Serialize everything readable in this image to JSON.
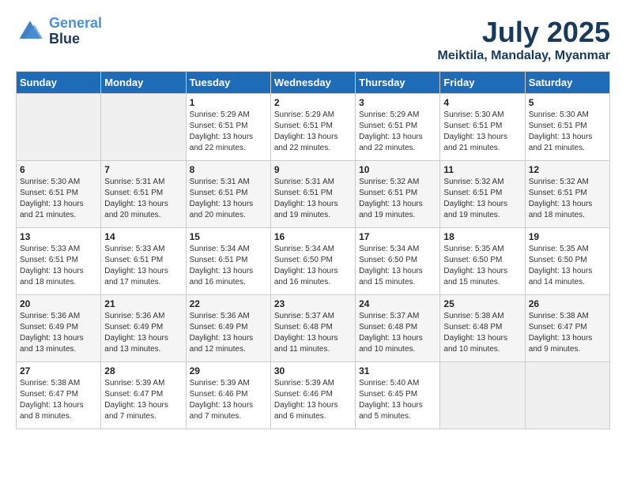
{
  "header": {
    "logo_line1": "General",
    "logo_line2": "Blue",
    "month": "July 2025",
    "location": "Meiktila, Mandalay, Myanmar"
  },
  "weekdays": [
    "Sunday",
    "Monday",
    "Tuesday",
    "Wednesday",
    "Thursday",
    "Friday",
    "Saturday"
  ],
  "weeks": [
    [
      {
        "day": "",
        "empty": true
      },
      {
        "day": "",
        "empty": true
      },
      {
        "day": "1",
        "sunrise": "5:29 AM",
        "sunset": "6:51 PM",
        "daylight": "13 hours and 22 minutes."
      },
      {
        "day": "2",
        "sunrise": "5:29 AM",
        "sunset": "6:51 PM",
        "daylight": "13 hours and 22 minutes."
      },
      {
        "day": "3",
        "sunrise": "5:29 AM",
        "sunset": "6:51 PM",
        "daylight": "13 hours and 22 minutes."
      },
      {
        "day": "4",
        "sunrise": "5:30 AM",
        "sunset": "6:51 PM",
        "daylight": "13 hours and 21 minutes."
      },
      {
        "day": "5",
        "sunrise": "5:30 AM",
        "sunset": "6:51 PM",
        "daylight": "13 hours and 21 minutes."
      }
    ],
    [
      {
        "day": "6",
        "sunrise": "5:30 AM",
        "sunset": "6:51 PM",
        "daylight": "13 hours and 21 minutes."
      },
      {
        "day": "7",
        "sunrise": "5:31 AM",
        "sunset": "6:51 PM",
        "daylight": "13 hours and 20 minutes."
      },
      {
        "day": "8",
        "sunrise": "5:31 AM",
        "sunset": "6:51 PM",
        "daylight": "13 hours and 20 minutes."
      },
      {
        "day": "9",
        "sunrise": "5:31 AM",
        "sunset": "6:51 PM",
        "daylight": "13 hours and 19 minutes."
      },
      {
        "day": "10",
        "sunrise": "5:32 AM",
        "sunset": "6:51 PM",
        "daylight": "13 hours and 19 minutes."
      },
      {
        "day": "11",
        "sunrise": "5:32 AM",
        "sunset": "6:51 PM",
        "daylight": "13 hours and 19 minutes."
      },
      {
        "day": "12",
        "sunrise": "5:32 AM",
        "sunset": "6:51 PM",
        "daylight": "13 hours and 18 minutes."
      }
    ],
    [
      {
        "day": "13",
        "sunrise": "5:33 AM",
        "sunset": "6:51 PM",
        "daylight": "13 hours and 18 minutes."
      },
      {
        "day": "14",
        "sunrise": "5:33 AM",
        "sunset": "6:51 PM",
        "daylight": "13 hours and 17 minutes."
      },
      {
        "day": "15",
        "sunrise": "5:34 AM",
        "sunset": "6:51 PM",
        "daylight": "13 hours and 16 minutes."
      },
      {
        "day": "16",
        "sunrise": "5:34 AM",
        "sunset": "6:50 PM",
        "daylight": "13 hours and 16 minutes."
      },
      {
        "day": "17",
        "sunrise": "5:34 AM",
        "sunset": "6:50 PM",
        "daylight": "13 hours and 15 minutes."
      },
      {
        "day": "18",
        "sunrise": "5:35 AM",
        "sunset": "6:50 PM",
        "daylight": "13 hours and 15 minutes."
      },
      {
        "day": "19",
        "sunrise": "5:35 AM",
        "sunset": "6:50 PM",
        "daylight": "13 hours and 14 minutes."
      }
    ],
    [
      {
        "day": "20",
        "sunrise": "5:36 AM",
        "sunset": "6:49 PM",
        "daylight": "13 hours and 13 minutes."
      },
      {
        "day": "21",
        "sunrise": "5:36 AM",
        "sunset": "6:49 PM",
        "daylight": "13 hours and 13 minutes."
      },
      {
        "day": "22",
        "sunrise": "5:36 AM",
        "sunset": "6:49 PM",
        "daylight": "13 hours and 12 minutes."
      },
      {
        "day": "23",
        "sunrise": "5:37 AM",
        "sunset": "6:48 PM",
        "daylight": "13 hours and 11 minutes."
      },
      {
        "day": "24",
        "sunrise": "5:37 AM",
        "sunset": "6:48 PM",
        "daylight": "13 hours and 10 minutes."
      },
      {
        "day": "25",
        "sunrise": "5:38 AM",
        "sunset": "6:48 PM",
        "daylight": "13 hours and 10 minutes."
      },
      {
        "day": "26",
        "sunrise": "5:38 AM",
        "sunset": "6:47 PM",
        "daylight": "13 hours and 9 minutes."
      }
    ],
    [
      {
        "day": "27",
        "sunrise": "5:38 AM",
        "sunset": "6:47 PM",
        "daylight": "13 hours and 8 minutes."
      },
      {
        "day": "28",
        "sunrise": "5:39 AM",
        "sunset": "6:47 PM",
        "daylight": "13 hours and 7 minutes."
      },
      {
        "day": "29",
        "sunrise": "5:39 AM",
        "sunset": "6:46 PM",
        "daylight": "13 hours and 7 minutes."
      },
      {
        "day": "30",
        "sunrise": "5:39 AM",
        "sunset": "6:46 PM",
        "daylight": "13 hours and 6 minutes."
      },
      {
        "day": "31",
        "sunrise": "5:40 AM",
        "sunset": "6:45 PM",
        "daylight": "13 hours and 5 minutes."
      },
      {
        "day": "",
        "empty": true
      },
      {
        "day": "",
        "empty": true
      }
    ]
  ]
}
